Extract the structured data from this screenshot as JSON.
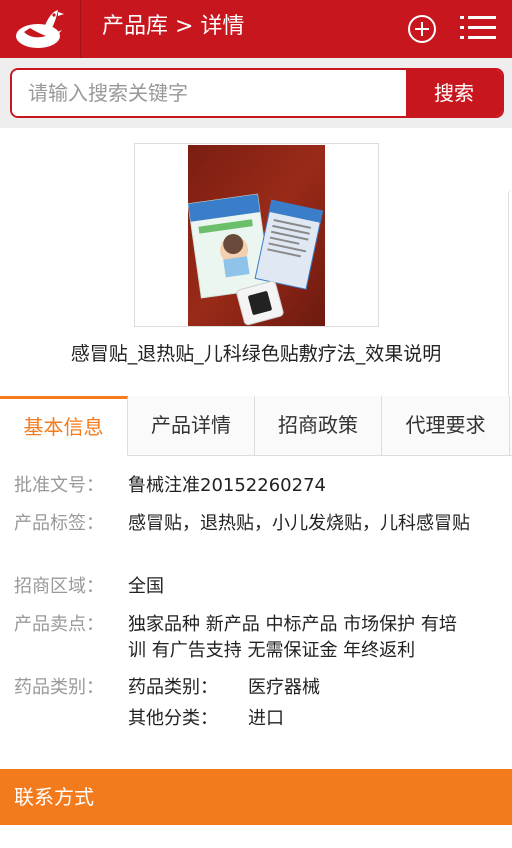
{
  "header": {
    "title": "产品库 > 详情",
    "accent_color": "#c8161e"
  },
  "search": {
    "placeholder": "请输入搜索关键字",
    "value": "",
    "button_label": "搜索"
  },
  "product": {
    "name": "感冒贴_退热贴_儿科绿色贴敷疗法_效果说明"
  },
  "tabs": [
    {
      "label": "基本信息",
      "active": true
    },
    {
      "label": "产品详情",
      "active": false
    },
    {
      "label": "招商政策",
      "active": false
    },
    {
      "label": "代理要求",
      "active": false
    }
  ],
  "info": {
    "approval": {
      "label": "批准文号：",
      "value": "鲁械注准20152260274"
    },
    "tags": {
      "label": "产品标签：",
      "value": "感冒贴，退热贴，小儿发烧贴，儿科感冒贴"
    },
    "region": {
      "label": "招商区域：",
      "value": "全国"
    },
    "selling_points": {
      "label": "产品卖点：",
      "value": "独家品种 新产品 中标产品 市场保护 有培训 有广告支持 无需保证金 年终返利"
    },
    "category": {
      "label": "药品类别：",
      "items": [
        {
          "label": "药品类别：",
          "value": "医疗器械"
        },
        {
          "label": "其他分类：",
          "value": "进口"
        }
      ]
    }
  },
  "contact": {
    "title": "联系方式",
    "color": "#f37b1d"
  },
  "icons": {
    "logo": "bird-logo-icon",
    "add": "plus-circle-icon",
    "menu": "list-menu-icon"
  }
}
